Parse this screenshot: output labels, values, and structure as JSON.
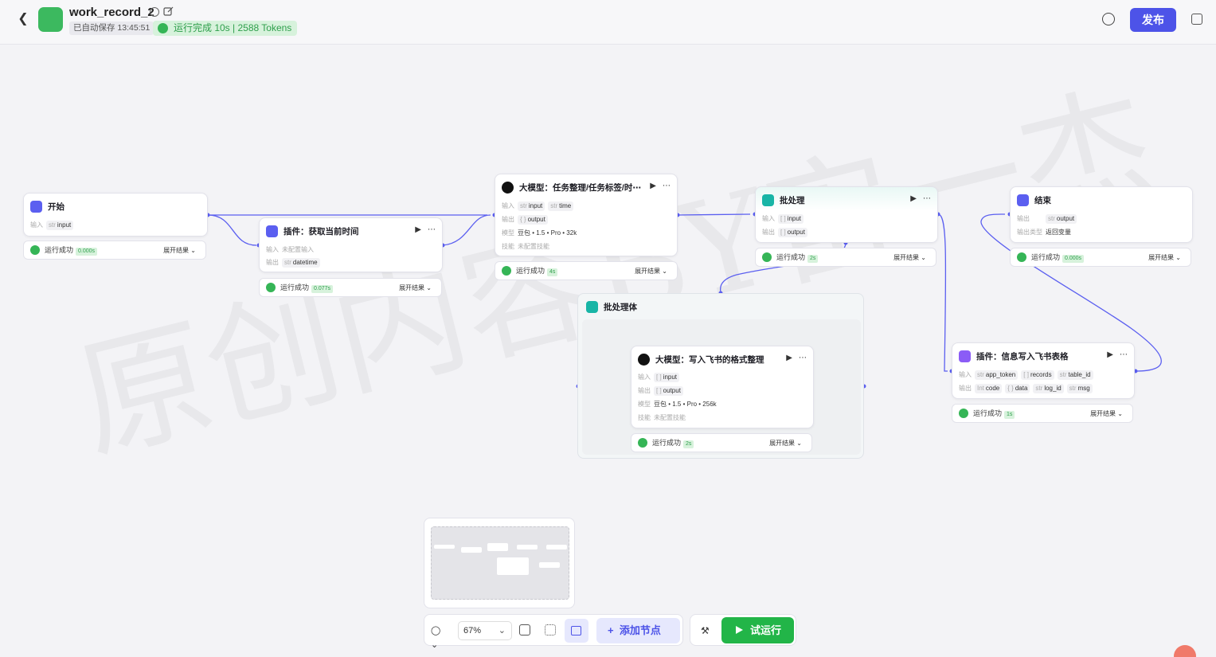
{
  "header": {
    "title": "work_record_2",
    "autosave": "已自动保存 13:45:51",
    "run_status": "运行完成 10s | 2588 Tokens",
    "publish_label": "发布"
  },
  "watermark": "原创内容BY宙一杰",
  "labels": {
    "input": "输入",
    "output": "输出",
    "model": "模型",
    "skill": "技能",
    "output_type": "输出类型",
    "run_success": "运行成功",
    "expand_result": "展开结果 ⌄",
    "no_skill": "未配置技能",
    "no_input": "未配置输入"
  },
  "nodes": {
    "start": {
      "title": "开始",
      "input_tag": "input",
      "time": "0.000s"
    },
    "plugin_time": {
      "title": "插件：获取当前时间",
      "output_tag": "datetime",
      "time": "0.077s"
    },
    "llm_task": {
      "title": "大模型：任务整理/任务标签/时⋯",
      "in1": "input",
      "in2": "time",
      "out1": "output",
      "model": "豆包 • 1.5 • Pro • 32k",
      "time": "4s"
    },
    "batch": {
      "title": "批处理",
      "in1": "input",
      "out1": "output",
      "time": "2s"
    },
    "end": {
      "title": "结束",
      "out1": "output",
      "out_type": "返回变量",
      "time": "0.000s"
    },
    "batch_body": {
      "title": "批处理体"
    },
    "llm_format": {
      "title": "大模型：写入飞书的格式整理",
      "in1": "input",
      "out1": "output",
      "model": "豆包 • 1.5 • Pro • 256k",
      "time": "2s"
    },
    "plugin_sheet": {
      "title": "插件：信息写入飞书表格",
      "in1": "app_token",
      "in2": "records",
      "in3": "table_id",
      "out1": "code",
      "out2": "data",
      "out3": "log_id",
      "out4": "msg",
      "time": "1s"
    }
  },
  "toolbar": {
    "zoom": "67%",
    "add_node": "添加节点",
    "test_run": "试运行"
  },
  "colors": {
    "accent": "#4d53e8",
    "success": "#35b556",
    "edge": "#5b5ff0"
  }
}
